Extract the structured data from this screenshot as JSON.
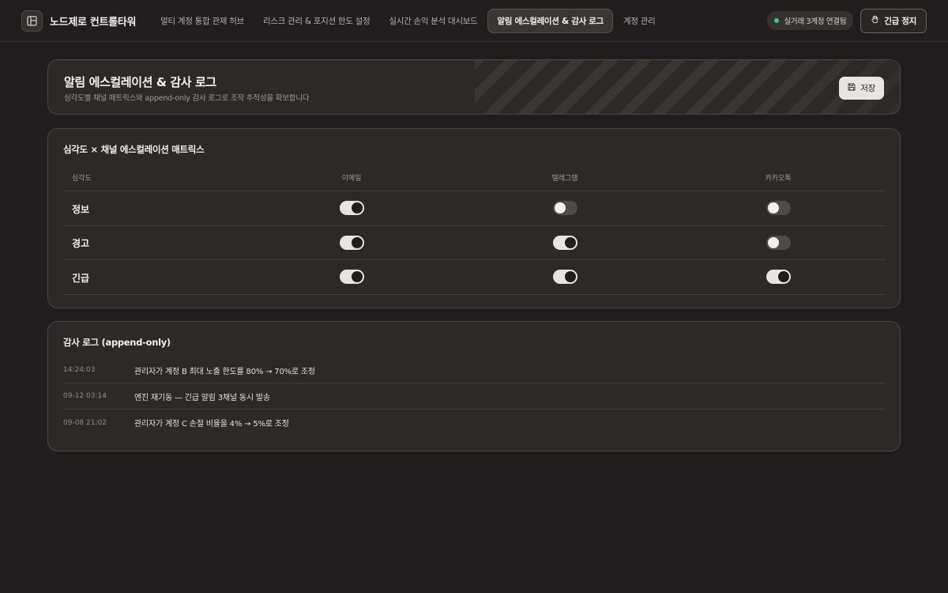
{
  "app": {
    "brand_name": "노드제로 컨트롤타워",
    "brand_icon": "layout-icon"
  },
  "nav": {
    "items": [
      {
        "label": "멀티 계정 통합 관제 허브",
        "active": false
      },
      {
        "label": "리스크 관리 & 포지션 한도 설정",
        "active": false
      },
      {
        "label": "실시간 손익 분석 대시보드",
        "active": false
      },
      {
        "label": "알림 에스컬레이션 & 감사 로그",
        "active": true
      },
      {
        "label": "계정 관리",
        "active": false
      }
    ]
  },
  "status": {
    "live_label": "실거래 3계정 연결됨",
    "live_color": "#3fd07a",
    "estop_label": "긴급 정지",
    "estop_icon": "hand-stop-icon"
  },
  "hero": {
    "title": "알림 에스컬레이션 & 감사 로그",
    "subtitle": "심각도별 채널 매트릭스와 append-only 감사 로그로 조작 추적성을 확보합니다",
    "save_label": "저장",
    "save_icon": "floppy-disk-icon"
  },
  "matrix": {
    "title": "심각도 × 채널 에스컬레이션 매트릭스",
    "headers": {
      "severity": "심각도",
      "email": "이메일",
      "telegram": "텔레그램",
      "kakao": "카카오톡"
    },
    "rows": [
      {
        "severity": "정보",
        "email": true,
        "telegram": false,
        "kakao": false
      },
      {
        "severity": "경고",
        "email": true,
        "telegram": true,
        "kakao": false
      },
      {
        "severity": "긴급",
        "email": true,
        "telegram": true,
        "kakao": true
      }
    ]
  },
  "audit": {
    "title": "감사 로그 (append-only)",
    "entries": [
      {
        "time": "14:24:03",
        "message": "관리자가 계정 B 최대 노출 한도를 80% → 70%로 조정"
      },
      {
        "time": "09-12 03:14",
        "message": "엔진 재기동 — 긴급 알림 3채널 동시 발송"
      },
      {
        "time": "09-08 21:02",
        "message": "관리자가 계정 C 손절 비율을 4% → 5%로 조정"
      }
    ]
  }
}
